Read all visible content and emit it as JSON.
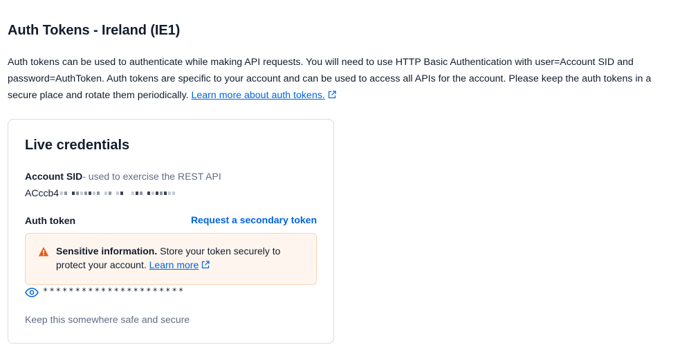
{
  "page": {
    "title": "Auth Tokens - Ireland (IE1)",
    "description": "Auth tokens can be used to authenticate while making API requests. You will need to use HTTP Basic Authentication with user=Account SID and password=AuthToken. Auth tokens are specific to your account and can be used to access all APIs for the account. Please keep the auth tokens in a secure place and rotate them periodically.",
    "learn_more_link": "Learn more about auth tokens."
  },
  "card": {
    "title": "Live credentials",
    "account_sid_label": "Account SID",
    "account_sid_help": "- used to exercise the REST API",
    "account_sid_value": "ACccb4",
    "auth_token_label": "Auth token",
    "secondary_token_button": "Request a secondary token",
    "warning": {
      "title": "Sensitive information.",
      "text": "Store your token securely to protect your account.",
      "link": "Learn more"
    },
    "masked_token": "**********************",
    "footnote": "Keep this somewhere safe and secure"
  },
  "icons": {
    "external_link": "external-link-icon",
    "warning": "warning-triangle-icon",
    "show_token": "eye-icon"
  },
  "colors": {
    "link": "#0263e0",
    "warning_bg": "#fef5ee",
    "warning_border": "#fcd3b4",
    "warning_icon": "#e05c1b",
    "muted_text": "#606b85"
  }
}
